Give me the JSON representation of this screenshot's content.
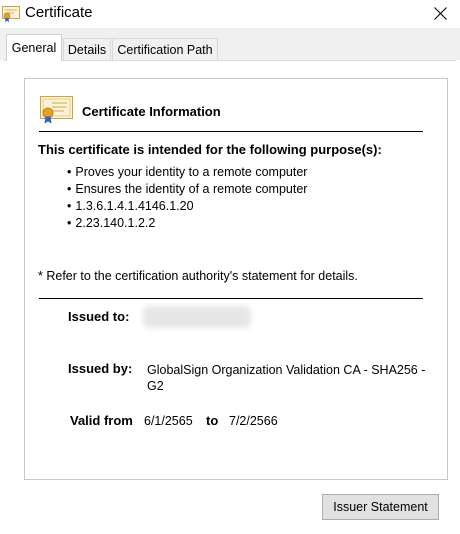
{
  "window": {
    "title": "Certificate",
    "icon": "certificate-icon",
    "close_icon": "close-icon"
  },
  "tabs": [
    {
      "label": "General",
      "active": true
    },
    {
      "label": "Details",
      "active": false
    },
    {
      "label": "Certification Path",
      "active": false
    }
  ],
  "info": {
    "heading": "Certificate Information",
    "icon": "certificate-icon",
    "purpose_title": "This certificate is intended for the following purpose(s):",
    "purposes": [
      "Proves your identity to a remote computer",
      "Ensures the identity of a remote computer",
      "1.3.6.1.4.1.4146.1.20",
      "2.23.140.1.2.2"
    ],
    "footnote": "* Refer to the certification authority's statement for details.",
    "issued_to_label": "Issued to:",
    "issued_by_label": "Issued by:",
    "issued_by_value": "GlobalSign Organization Validation CA - SHA256 - G2",
    "valid_from_label": "Valid from",
    "valid_from_value": "6/1/2565",
    "to_label": "to",
    "valid_to_value": "7/2/2566"
  },
  "buttons": {
    "issuer_statement": "Issuer Statement"
  },
  "colors": {
    "tab_strip": "#f0f0f0",
    "button_face": "#e1e1e1",
    "button_border": "#adadad",
    "box_border": "#c9c9c9"
  }
}
